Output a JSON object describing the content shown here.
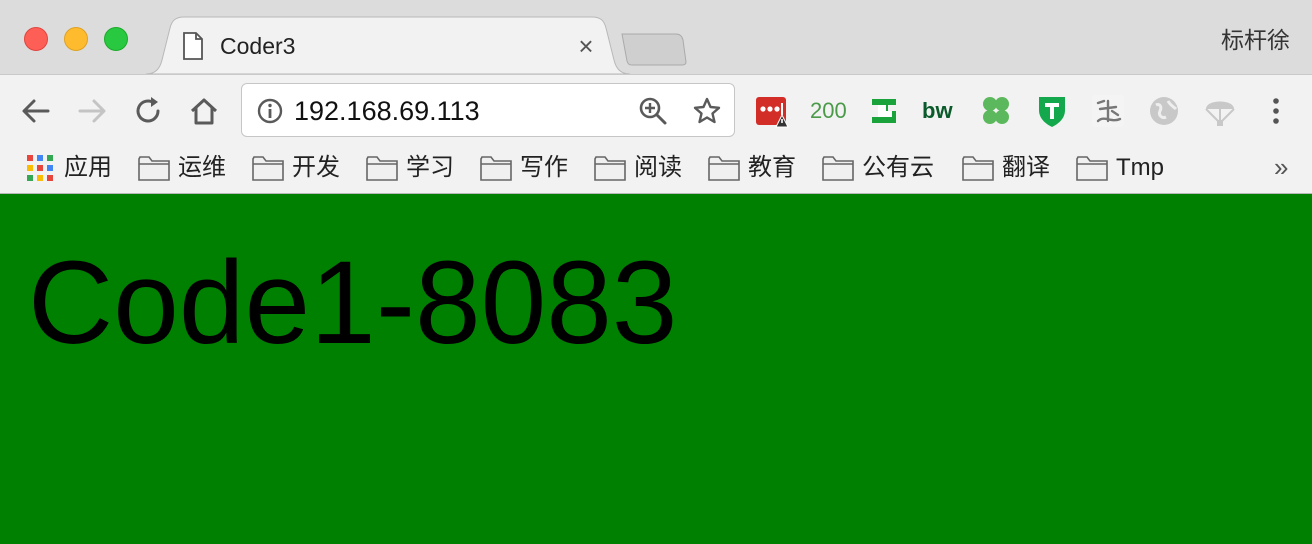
{
  "window": {
    "profile_name": "标杆徐"
  },
  "tab": {
    "title": "Coder3",
    "icon": "document-icon"
  },
  "toolbar": {
    "url": "192.168.69.113",
    "extensions": [
      {
        "name": "lastpass-extension-icon",
        "color": "#d32d27"
      },
      {
        "name": "http-status-200",
        "label": "200",
        "color": "#4a9a4a"
      },
      {
        "name": "grammarly-extension-icon",
        "color": "#1a9a3a"
      },
      {
        "name": "bw-extension-icon",
        "label": "bw",
        "color": "#0a5a2a"
      },
      {
        "name": "clover-extension-icon",
        "color": "#5cb85c"
      },
      {
        "name": "shield-t-extension-icon",
        "color": "#12a84b"
      },
      {
        "name": "calligraphy-extension-icon",
        "color": "#888888"
      },
      {
        "name": "globe-extension-icon",
        "color": "#b0b0b0"
      },
      {
        "name": "parachute-extension-icon",
        "color": "#b8b8b8"
      },
      {
        "name": "more-menu-icon",
        "color": "#555555"
      }
    ]
  },
  "bookmarks": {
    "apps_label": "应用",
    "folders": [
      "运维",
      "开发",
      "学习",
      "写作",
      "阅读",
      "教育",
      "公有云",
      "翻译",
      "Tmp"
    ],
    "overflow_label": "»"
  },
  "page": {
    "heading": "Code1-8083",
    "background_color": "#008000"
  }
}
